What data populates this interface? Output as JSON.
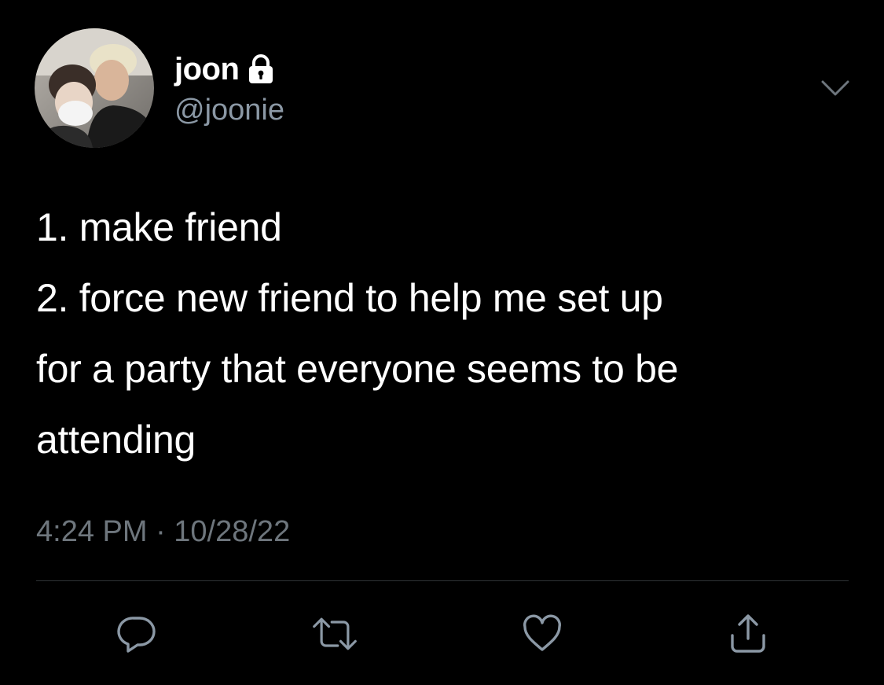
{
  "user": {
    "display_name": "joon",
    "handle": "@joonie",
    "avatar_icon": "profile-photo",
    "protected_icon": "lock-icon"
  },
  "tweet": {
    "lines": [
      "1. make friend",
      "2. force new friend to help me set up",
      "for a party that everyone seems to be",
      "attending"
    ],
    "timestamp": "4:24 PM · 10/28/22"
  },
  "actions": [
    {
      "icon": "reply-icon"
    },
    {
      "icon": "retweet-icon"
    },
    {
      "icon": "like-icon"
    },
    {
      "icon": "share-icon"
    }
  ],
  "colors": {
    "background": "#000000",
    "text": "#ffffff",
    "secondary": "#8b98a5",
    "timestamp": "#6e767d",
    "icon": "#8b98a5",
    "divider": "#2f3336"
  }
}
